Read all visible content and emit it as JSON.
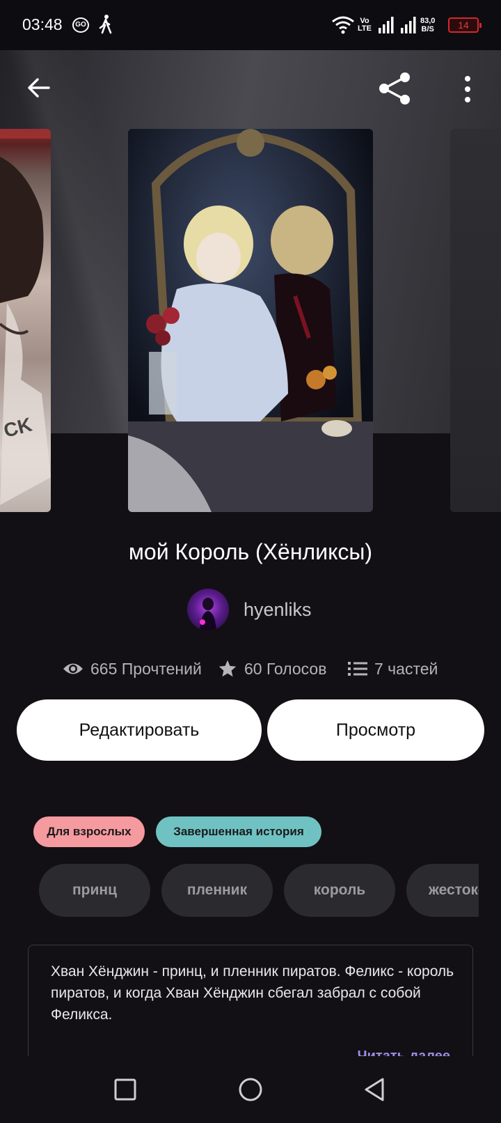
{
  "status_bar": {
    "time": "03:48",
    "go_label": "GO",
    "volte_line1": "Vo",
    "volte_line2": "LTE",
    "speed_value": "83,0",
    "speed_unit": "B/S",
    "battery": "14"
  },
  "story": {
    "title": "мой Король (Хёнликсы)",
    "author": "hyenliks",
    "stats": {
      "reads": "665 Прочтений",
      "votes": "60 Голосов",
      "parts": "7 частей"
    },
    "buttons": {
      "edit": "Редактировать",
      "view": "Просмотр"
    },
    "badges": {
      "mature": "Для взрослых",
      "complete": "Завершенная история"
    },
    "tags": [
      "принц",
      "пленник",
      "король",
      "жестокость"
    ],
    "description": "Хван Хёнджин - принц, и пленник пиратов. Феликс - король пиратов, и когда Хван Хёнджин  сбегал забрал с собой Феликса.",
    "read_more": "Читать далее"
  },
  "colors": {
    "background": "#121015",
    "mature_badge": "#f59a9f",
    "complete_badge": "#70c2c2",
    "read_more": "#9b8fe6",
    "battery_low": "#d6262b"
  },
  "icons": {
    "back": "arrow-left-icon",
    "share": "share-icon",
    "more": "more-vertical-icon",
    "reads": "eye-icon",
    "votes": "star-icon",
    "parts": "list-icon",
    "nav_recent": "square-icon",
    "nav_home": "circle-icon",
    "nav_back": "triangle-back-icon"
  }
}
